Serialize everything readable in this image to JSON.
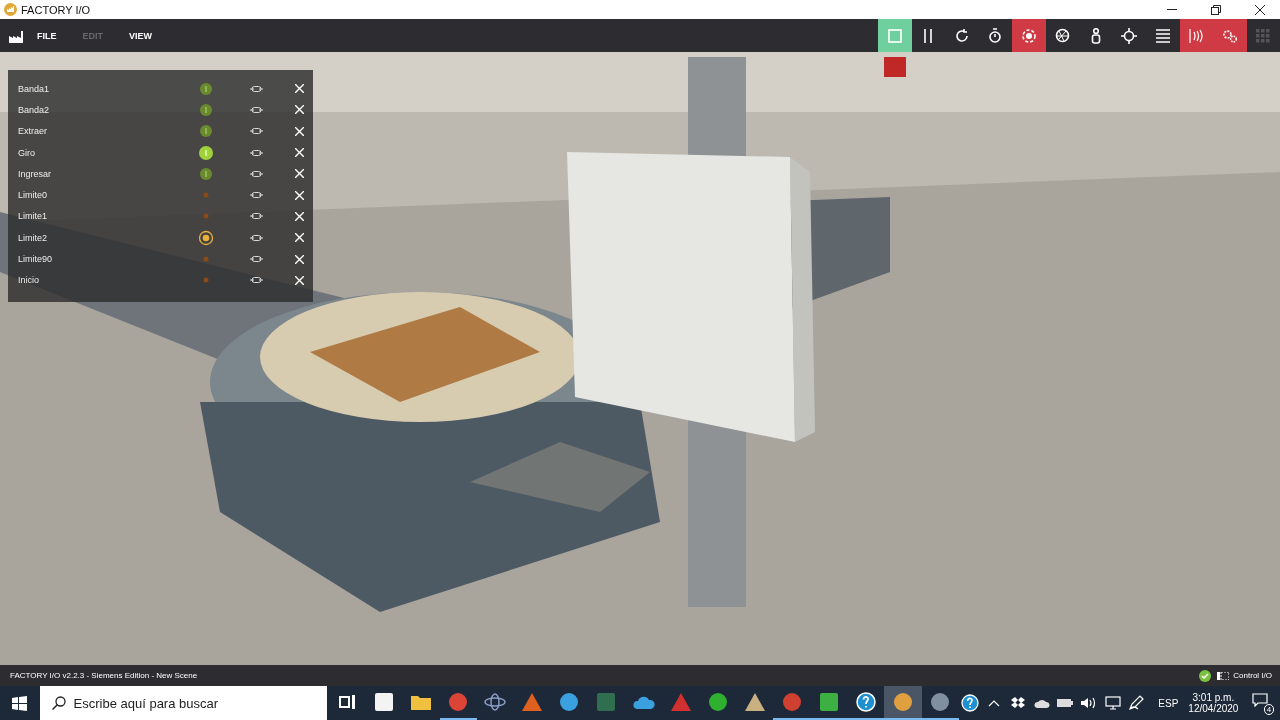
{
  "window": {
    "title": "FACTORY I/O"
  },
  "menu": [
    {
      "label": "FILE",
      "disabled": false
    },
    {
      "label": "EDIT",
      "disabled": true
    },
    {
      "label": "VIEW",
      "disabled": false
    }
  ],
  "toolbar": [
    {
      "kind": "stop",
      "color": "#6fcf9f"
    },
    {
      "kind": "pause"
    },
    {
      "kind": "reset"
    },
    {
      "kind": "timer"
    },
    {
      "kind": "target",
      "color": "#d03a44"
    },
    {
      "kind": "aperture"
    },
    {
      "kind": "person"
    },
    {
      "kind": "crosshair"
    },
    {
      "kind": "list"
    },
    {
      "kind": "signal",
      "color": "#d03a44"
    },
    {
      "kind": "gears",
      "color": "#d03a44"
    },
    {
      "kind": "grid"
    }
  ],
  "tags": [
    {
      "name": "Banda1",
      "kind": "actuator",
      "on": false
    },
    {
      "name": "Banda2",
      "kind": "actuator",
      "on": false
    },
    {
      "name": "Extraer",
      "kind": "actuator",
      "on": false
    },
    {
      "name": "Giro",
      "kind": "actuator",
      "on": true
    },
    {
      "name": "Ingresar",
      "kind": "actuator",
      "on": false
    },
    {
      "name": "Limite0",
      "kind": "sensor",
      "on": false
    },
    {
      "name": "Limite1",
      "kind": "sensor",
      "on": false
    },
    {
      "name": "Limite2",
      "kind": "sensor",
      "on": true
    },
    {
      "name": "Limite90",
      "kind": "sensor",
      "on": false
    },
    {
      "name": "Inicio",
      "kind": "sensor",
      "on": false
    }
  ],
  "status_bar": {
    "text": "FACTORY I/O v2.2.3 - Siemens Edition - New Scene",
    "driver": "Control I/O"
  },
  "taskbar": {
    "search": {
      "placeholder": "Escribe aquí para buscar"
    },
    "apps": [
      {
        "kind": "taskview",
        "color": "#ffffff",
        "running": false,
        "selected": false
      },
      {
        "kind": "square",
        "color": "#f3f3f3",
        "running": false,
        "selected": false
      },
      {
        "kind": "folder",
        "color": "#f0c040",
        "running": false,
        "selected": false
      },
      {
        "kind": "circle",
        "color": "#db4437",
        "running": true,
        "selected": false
      },
      {
        "kind": "atom",
        "color": "#8aa0c8",
        "running": false,
        "selected": false
      },
      {
        "kind": "triangle",
        "color": "#e06020",
        "running": false,
        "selected": false
      },
      {
        "kind": "circle",
        "color": "#3aa0e0",
        "running": false,
        "selected": false
      },
      {
        "kind": "square",
        "color": "#2f6f4f",
        "running": false,
        "selected": false
      },
      {
        "kind": "cloud",
        "color": "#3aa0e0",
        "running": false,
        "selected": false
      },
      {
        "kind": "triangle",
        "color": "#d03030",
        "running": false,
        "selected": false
      },
      {
        "kind": "circle",
        "color": "#30b030",
        "running": false,
        "selected": false
      },
      {
        "kind": "triangle",
        "color": "#c8b080",
        "running": false,
        "selected": false
      },
      {
        "kind": "circle",
        "color": "#d04030",
        "running": true,
        "selected": false
      },
      {
        "kind": "square",
        "color": "#3cb043",
        "running": true,
        "selected": false
      },
      {
        "kind": "help",
        "color": "#1e90d0",
        "running": true,
        "selected": false
      },
      {
        "kind": "circle",
        "color": "#e0a040",
        "running": true,
        "selected": true
      },
      {
        "kind": "circle",
        "color": "#8090a0",
        "running": true,
        "selected": false
      }
    ],
    "tray": [
      {
        "kind": "help"
      },
      {
        "kind": "caret"
      },
      {
        "kind": "dropbox"
      },
      {
        "kind": "cloud"
      },
      {
        "kind": "battery"
      },
      {
        "kind": "volume"
      },
      {
        "kind": "network"
      },
      {
        "kind": "pen"
      }
    ],
    "language": "ESP",
    "time": "3:01 p.m.",
    "date": "12/04/2020",
    "notifications": "4"
  }
}
